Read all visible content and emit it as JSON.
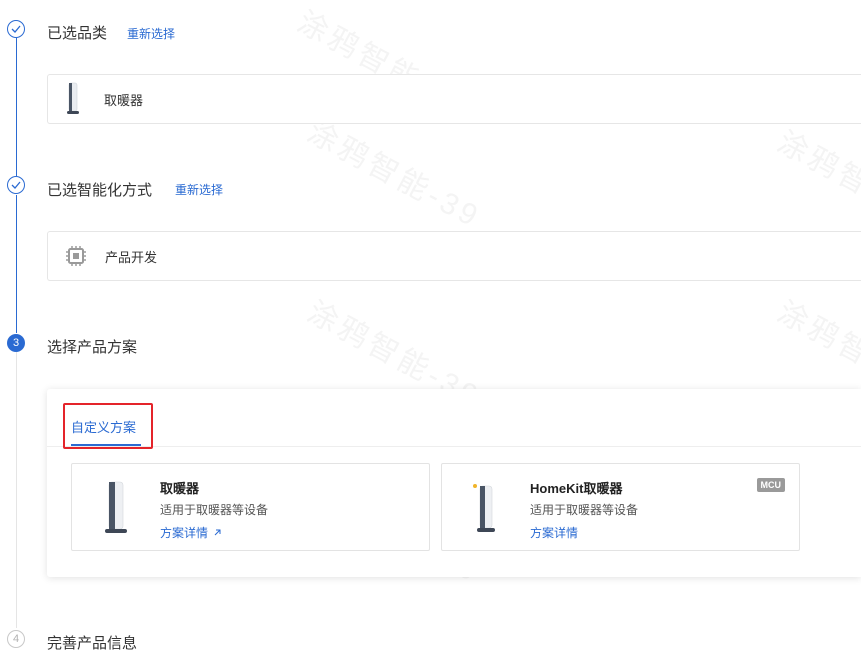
{
  "watermark": "涂鸦智能-39",
  "steps": [
    {
      "number": "1",
      "title": "已选品类",
      "action": "重新选择"
    },
    {
      "number": "2",
      "title": "已选智能化方式",
      "action": "重新选择"
    },
    {
      "number": "3",
      "title": "选择产品方案"
    },
    {
      "number": "4",
      "title": "完善产品信息"
    }
  ],
  "selected_category": {
    "icon": "heater-icon",
    "label": "取暖器"
  },
  "selected_mode": {
    "icon": "chip-icon",
    "label": "产品开发"
  },
  "solution_panel": {
    "tabs": [
      {
        "label": "自定义方案",
        "active": true
      }
    ],
    "cards": [
      {
        "name": "取暖器",
        "desc": "适用于取暖器等设备",
        "link": "方案详情",
        "link_icon": "external-arrow-icon",
        "badge": ""
      },
      {
        "name": "HomeKit取暖器",
        "desc": "适用于取暖器等设备",
        "link": "方案详情",
        "badge": "MCU"
      }
    ]
  },
  "colors": {
    "accent": "#2a6ad2",
    "highlight": "#e4242a",
    "badge": "#9a9a9a"
  }
}
